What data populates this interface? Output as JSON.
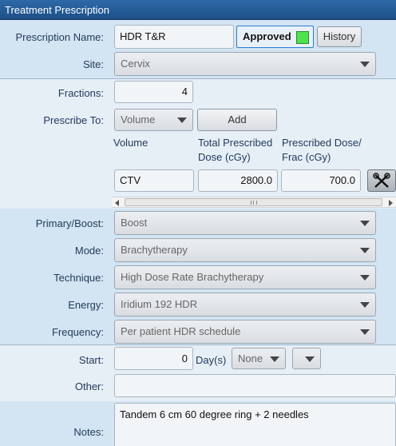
{
  "window": {
    "title": "Treatment Prescription"
  },
  "prescription": {
    "name_label": "Prescription Name:",
    "name_value": "HDR T&R",
    "approved_label": "Approved",
    "approved_color": "#4fe24f",
    "history_button": "History",
    "site_label": "Site:",
    "site_value": "Cervix"
  },
  "dose": {
    "fractions_label": "Fractions:",
    "fractions_value": "4",
    "prescribe_to_label": "Prescribe To:",
    "prescribe_to_value": "Volume",
    "add_button": "Add",
    "columns": [
      "Volume",
      "Total Prescribed Dose (cGy)",
      "Prescribed Dose/ Frac (cGy)"
    ],
    "row": {
      "volume": "CTV",
      "total_dose": "2800.0",
      "dose_per_frac": "700.0"
    }
  },
  "plan": {
    "primary_boost_label": "Primary/Boost:",
    "primary_boost_value": "Boost",
    "mode_label": "Mode:",
    "mode_value": "Brachytherapy",
    "technique_label": "Technique:",
    "technique_value": "High Dose Rate Brachytherapy",
    "energy_label": "Energy:",
    "energy_value": "Iridium 192 HDR",
    "frequency_label": "Frequency:",
    "frequency_value": "Per patient HDR schedule"
  },
  "schedule": {
    "start_label": "Start:",
    "start_value": "0",
    "days_label": "Day(s)",
    "relative_value": "None",
    "other_label": "Other:",
    "other_value": ""
  },
  "notes": {
    "label": "Notes:",
    "value": "Tandem 6 cm 60 degree ring + 2 needles"
  }
}
